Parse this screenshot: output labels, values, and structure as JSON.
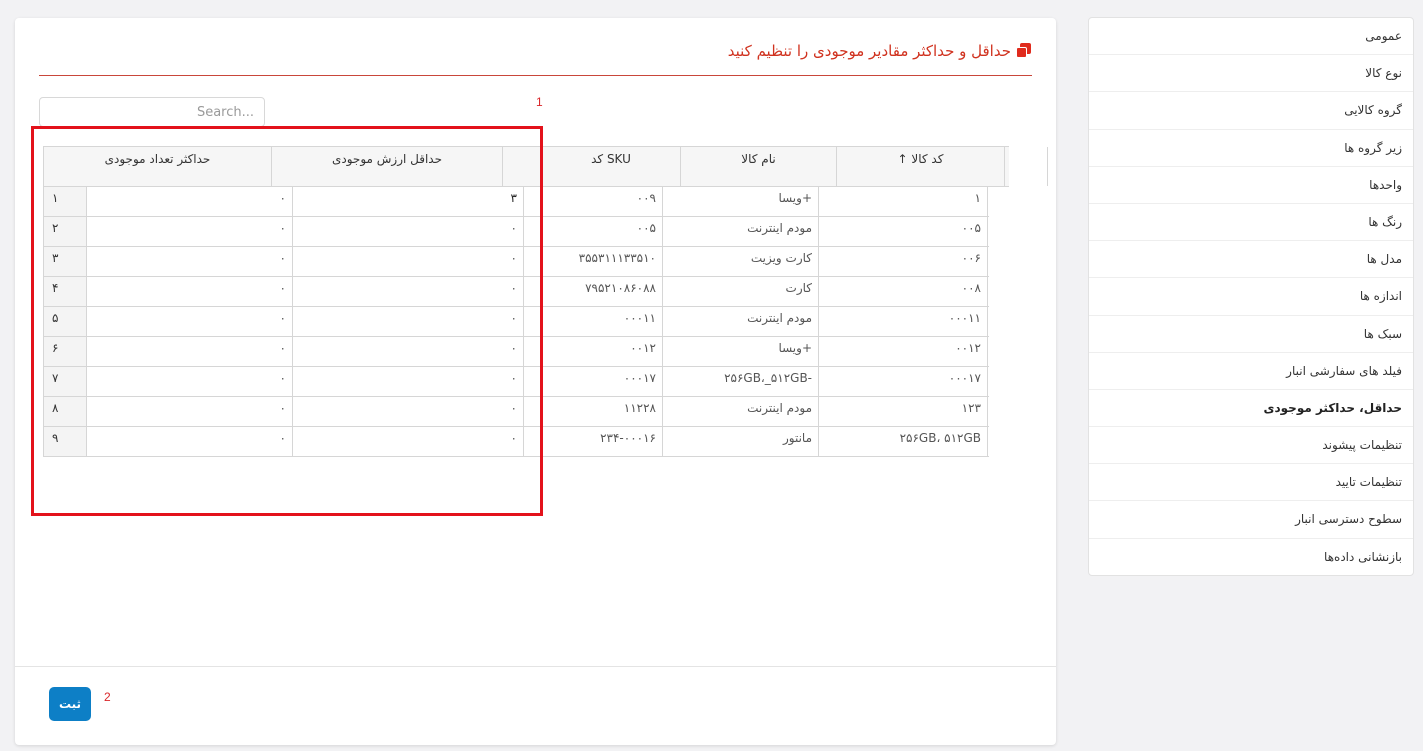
{
  "sidebar": {
    "items": [
      {
        "label": "عمومی"
      },
      {
        "label": "نوع کالا"
      },
      {
        "label": "گروه کالایی"
      },
      {
        "label": "زیر گروه ها"
      },
      {
        "label": "واحدها"
      },
      {
        "label": "رنگ ها"
      },
      {
        "label": "مدل ها"
      },
      {
        "label": "اندازه ها"
      },
      {
        "label": "سبک ها"
      },
      {
        "label": "فیلد های سفارشی انبار"
      },
      {
        "label": "حداقل، حداکثر موجودی"
      },
      {
        "label": "تنظیمات پیشوند"
      },
      {
        "label": "تنظیمات تایید"
      },
      {
        "label": "سطوح دسترسی انبار"
      },
      {
        "label": "بازنشانی داده‌ها"
      }
    ],
    "active_index": 10
  },
  "main": {
    "title": "حداقل و حداکثر مقادیر موجودی را تنظیم کنید",
    "search_placeholder": "Search...",
    "annotation_1": "1",
    "annotation_2": "2",
    "save_label": "ثبت"
  },
  "table": {
    "columns": {
      "code": "↑ کد کالا",
      "name": "نام کالا",
      "sku": "کد SKU",
      "min_value": "حداقل ارزش موجودی",
      "max_qty": "حداکثر تعداد موجودی"
    },
    "rows": [
      {
        "code": "۱",
        "name": "ویسا+",
        "sku": "۰۰۹",
        "min": "۳",
        "max": "۰",
        "n": "۱"
      },
      {
        "code": "۰۰۵",
        "name": "مودم اینترنت",
        "sku": "۰۰۵",
        "min": "۰",
        "max": "۰",
        "n": "۲"
      },
      {
        "code": "۰۰۶",
        "name": "کارت ویزیت",
        "sku": "۳۵۵۳۱۱۱۳۳۵۱۰",
        "min": "۰",
        "max": "۰",
        "n": "۳"
      },
      {
        "code": "۰۰۸",
        "name": "کارت",
        "sku": "۷۹۵۲۱۰۸۶۰۸۸",
        "min": "۰",
        "max": "۰",
        "n": "۴"
      },
      {
        "code": "۰۰۰۱۱",
        "name": "مودم اینترنت",
        "sku": "۰۰۰۱۱",
        "min": "۰",
        "max": "۰",
        "n": "۵"
      },
      {
        "code": "۰۰۱۲",
        "name": "ویسا+",
        "sku": "۰۰۱۲",
        "min": "۰",
        "max": "۰",
        "n": "۶"
      },
      {
        "code": "۰۰۰۱۷",
        "name": "۲۵۶GB،_۵۱۲GB-",
        "sku": "۰۰۰۱۷",
        "min": "۰",
        "max": "۰",
        "n": "۷"
      },
      {
        "code": "۱۲۳",
        "name": "مودم اینترنت",
        "sku": "۱۱۲۲۸",
        "min": "۰",
        "max": "۰",
        "n": "۸"
      },
      {
        "code": "۲۵۶GB، ۵۱۲GB",
        "name": "مانتور",
        "sku": "۲۳۴-۰۰۰۱۶",
        "min": "۰",
        "max": "۰",
        "n": "۹"
      }
    ]
  }
}
